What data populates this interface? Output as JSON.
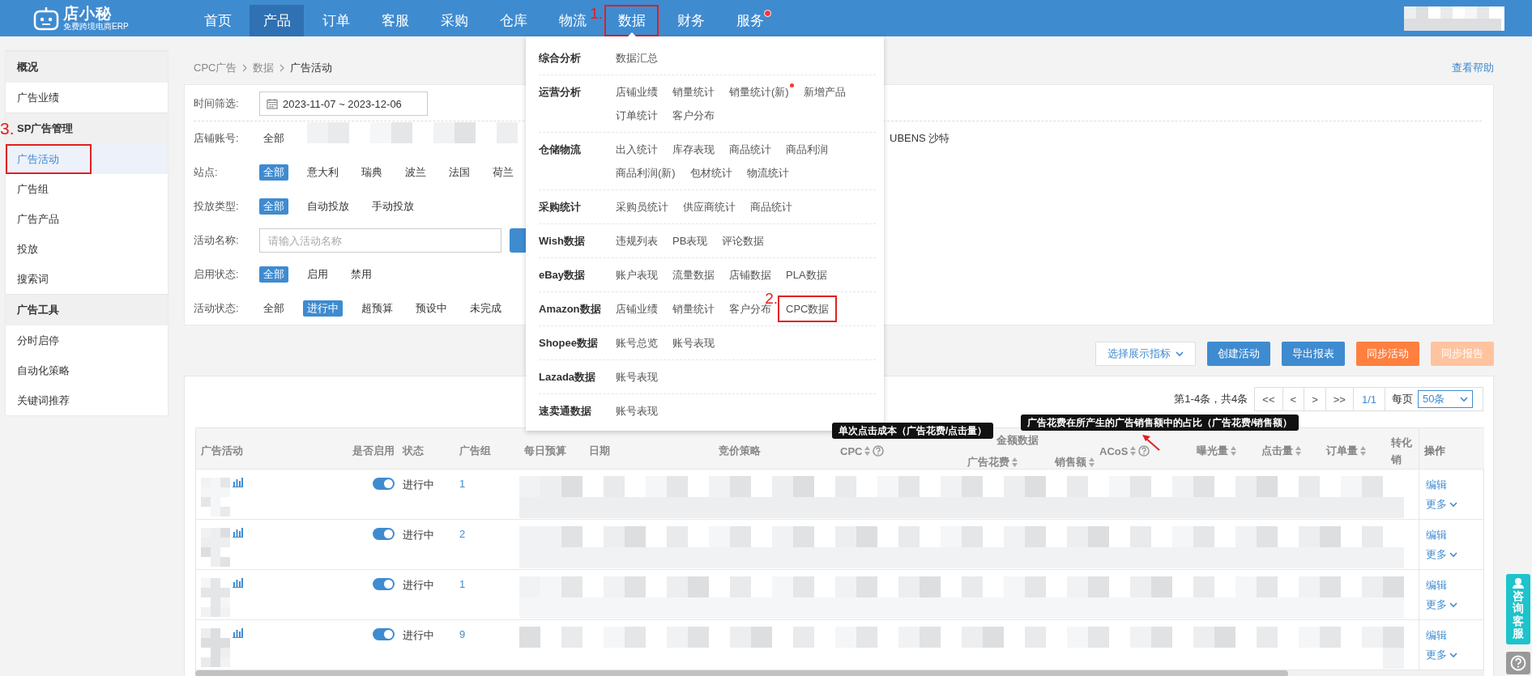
{
  "nav": {
    "logo": {
      "name": "店小秘",
      "tagline": "免费跨境电商ERP"
    },
    "items": [
      {
        "label": "首页",
        "selected": false,
        "expanded": false,
        "dot": false,
        "boxed": false
      },
      {
        "label": "产品",
        "selected": true,
        "expanded": false,
        "dot": false,
        "boxed": false
      },
      {
        "label": "订单",
        "selected": false,
        "expanded": false,
        "dot": false,
        "boxed": false
      },
      {
        "label": "客服",
        "selected": false,
        "expanded": false,
        "dot": false,
        "boxed": false
      },
      {
        "label": "采购",
        "selected": false,
        "expanded": false,
        "dot": false,
        "boxed": false
      },
      {
        "label": "仓库",
        "selected": false,
        "expanded": false,
        "dot": false,
        "boxed": false
      },
      {
        "label": "物流",
        "selected": false,
        "expanded": false,
        "dot": false,
        "boxed": false
      },
      {
        "label": "数据",
        "selected": false,
        "expanded": true,
        "dot": false,
        "boxed": true,
        "annotation": "1."
      },
      {
        "label": "财务",
        "selected": false,
        "expanded": false,
        "dot": false,
        "boxed": false
      },
      {
        "label": "服务",
        "selected": false,
        "expanded": false,
        "dot": true,
        "boxed": false
      }
    ]
  },
  "data_menu": {
    "groups": [
      {
        "title": "综合分析",
        "items": [
          {
            "label": "数据汇总",
            "dot": false,
            "boxed": false
          }
        ]
      },
      {
        "title": "运营分析",
        "items": [
          {
            "label": "店铺业绩",
            "dot": false,
            "boxed": false
          },
          {
            "label": "销量统计",
            "dot": false,
            "boxed": false
          },
          {
            "label": "销量统计(新)",
            "dot": true,
            "boxed": false
          },
          {
            "label": "新增产品",
            "dot": false,
            "boxed": false
          },
          {
            "label": "订单统计",
            "dot": false,
            "boxed": false
          },
          {
            "label": "客户分布",
            "dot": false,
            "boxed": false
          }
        ]
      },
      {
        "title": "仓储物流",
        "items": [
          {
            "label": "出入统计",
            "dot": false,
            "boxed": false
          },
          {
            "label": "库存表现",
            "dot": false,
            "boxed": false
          },
          {
            "label": "商品统计",
            "dot": false,
            "boxed": false
          },
          {
            "label": "商品利润",
            "dot": false,
            "boxed": false
          },
          {
            "label": "商品利润(新)",
            "dot": false,
            "boxed": false
          },
          {
            "label": "包材统计",
            "dot": false,
            "boxed": false
          },
          {
            "label": "物流统计",
            "dot": false,
            "boxed": false
          }
        ]
      },
      {
        "title": "采购统计",
        "items": [
          {
            "label": "采购员统计",
            "dot": false,
            "boxed": false
          },
          {
            "label": "供应商统计",
            "dot": false,
            "boxed": false
          },
          {
            "label": "商品统计",
            "dot": false,
            "boxed": false
          }
        ]
      },
      {
        "title": "Wish数据",
        "items": [
          {
            "label": "违规列表",
            "dot": false,
            "boxed": false
          },
          {
            "label": "PB表现",
            "dot": false,
            "boxed": false
          },
          {
            "label": "评论数据",
            "dot": false,
            "boxed": false
          }
        ]
      },
      {
        "title": "eBay数据",
        "items": [
          {
            "label": "账户表现",
            "dot": false,
            "boxed": false
          },
          {
            "label": "流量数据",
            "dot": false,
            "boxed": false
          },
          {
            "label": "店铺数据",
            "dot": false,
            "boxed": false
          },
          {
            "label": "PLA数据",
            "dot": false,
            "boxed": false
          }
        ]
      },
      {
        "title": "Amazon数据",
        "items": [
          {
            "label": "店铺业绩",
            "dot": false,
            "boxed": false
          },
          {
            "label": "销量统计",
            "dot": false,
            "boxed": false
          },
          {
            "label": "客户分布",
            "dot": false,
            "boxed": false
          },
          {
            "label": "CPC数据",
            "dot": false,
            "boxed": true,
            "annotation": "2."
          }
        ]
      },
      {
        "title": "Shopee数据",
        "items": [
          {
            "label": "账号总览",
            "dot": false,
            "boxed": false
          },
          {
            "label": "账号表现",
            "dot": false,
            "boxed": false
          }
        ]
      },
      {
        "title": "Lazada数据",
        "items": [
          {
            "label": "账号表现",
            "dot": false,
            "boxed": false
          }
        ]
      },
      {
        "title": "速卖通数据",
        "items": [
          {
            "label": "账号表现",
            "dot": false,
            "boxed": false
          }
        ]
      }
    ]
  },
  "sidebar": {
    "sections": [
      {
        "title": "概况",
        "items": [
          {
            "label": "广告业绩",
            "selected": false,
            "boxed": false
          }
        ]
      },
      {
        "title": "SP广告管理",
        "items": [
          {
            "label": "广告活动",
            "selected": true,
            "boxed": true,
            "annotation": "3."
          },
          {
            "label": "广告组",
            "selected": false,
            "boxed": false
          },
          {
            "label": "广告产品",
            "selected": false,
            "boxed": false
          },
          {
            "label": "投放",
            "selected": false,
            "boxed": false
          },
          {
            "label": "搜索词",
            "selected": false,
            "boxed": false
          }
        ]
      },
      {
        "title": "广告工具",
        "items": [
          {
            "label": "分时启停",
            "selected": false,
            "boxed": false
          },
          {
            "label": "自动化策略",
            "selected": false,
            "boxed": false
          },
          {
            "label": "关键词推荐",
            "selected": false,
            "boxed": false
          }
        ]
      }
    ]
  },
  "breadcrumb": [
    "CPC广告",
    "数据",
    "广告活动"
  ],
  "help_link": "查看帮助",
  "filters": [
    {
      "kind": "date",
      "label": "时间筛选:",
      "value": "2023-11-07 ~ 2023-12-06"
    },
    {
      "kind": "accounts",
      "label": "店铺账号:",
      "options": [
        {
          "label": "全部",
          "selected": false
        }
      ],
      "tail": "UBENS 沙特"
    },
    {
      "kind": "options",
      "label": "站点:",
      "options": [
        {
          "label": "全部",
          "selected": true
        },
        {
          "label": "意大利",
          "selected": false
        },
        {
          "label": "瑞典",
          "selected": false
        },
        {
          "label": "波兰",
          "selected": false
        },
        {
          "label": "法国",
          "selected": false
        },
        {
          "label": "荷兰",
          "selected": false
        }
      ]
    },
    {
      "kind": "options",
      "label": "投放类型:",
      "options": [
        {
          "label": "全部",
          "selected": true
        },
        {
          "label": "自动投放",
          "selected": false
        },
        {
          "label": "手动投放",
          "selected": false
        }
      ]
    },
    {
      "kind": "text",
      "label": "活动名称:",
      "placeholder": "请输入活动名称"
    },
    {
      "kind": "options",
      "label": "启用状态:",
      "options": [
        {
          "label": "全部",
          "selected": true
        },
        {
          "label": "启用",
          "selected": false
        },
        {
          "label": "禁用",
          "selected": false
        }
      ]
    },
    {
      "kind": "options",
      "label": "活动状态:",
      "options": [
        {
          "label": "全部",
          "selected": false
        },
        {
          "label": "进行中",
          "selected": true
        },
        {
          "label": "超预算",
          "selected": false
        },
        {
          "label": "预设中",
          "selected": false
        },
        {
          "label": "未完成",
          "selected": false
        }
      ]
    }
  ],
  "toolbar": [
    {
      "label": "选择展示指标",
      "kind": "dropdown",
      "disabled": false
    },
    {
      "label": "创建活动",
      "kind": "primary",
      "disabled": false
    },
    {
      "label": "导出报表",
      "kind": "primary",
      "disabled": false
    },
    {
      "label": "同步活动",
      "kind": "warning",
      "disabled": false
    },
    {
      "label": "同步报告",
      "kind": "warning",
      "disabled": true
    }
  ],
  "pagination": {
    "summary": "第1-4条，共4条",
    "buttons": [
      "<<",
      "<",
      ">",
      ">>"
    ],
    "page": "1/1",
    "per_page_label": "每页",
    "per_page": "50条"
  },
  "table": {
    "columns": [
      {
        "kind": "plain",
        "label": "广告活动",
        "sortable": false,
        "help": false
      },
      {
        "kind": "plain",
        "label": "是否启用",
        "sortable": false,
        "help": false
      },
      {
        "kind": "plain",
        "label": "状态",
        "sortable": false,
        "help": false
      },
      {
        "kind": "plain",
        "label": "广告组",
        "sortable": false,
        "help": false
      },
      {
        "kind": "plain",
        "label": "每日预算",
        "sortable": false,
        "help": false
      },
      {
        "kind": "plain",
        "label": "日期",
        "sortable": false,
        "help": false
      },
      {
        "kind": "plain",
        "label": "竞价策略",
        "sortable": false,
        "help": false
      },
      {
        "kind": "plain",
        "label": "CPC",
        "sortable": true,
        "help": true
      },
      {
        "kind": "group",
        "label": "金额数据",
        "columns": [
          {
            "label": "广告花费",
            "sortable": true,
            "help": false
          },
          {
            "label": "销售额",
            "sortable": true,
            "help": false
          }
        ]
      },
      {
        "kind": "plain",
        "label": "ACoS",
        "sortable": true,
        "help": true
      },
      {
        "kind": "plain",
        "label": "曝光量",
        "sortable": true,
        "help": false
      },
      {
        "kind": "plain",
        "label": "点击量",
        "sortable": true,
        "help": false
      },
      {
        "kind": "plain",
        "label": "订单量",
        "sortable": true,
        "help": false
      },
      {
        "kind": "cut",
        "label": "转化",
        "sub_label": "销"
      },
      {
        "kind": "plain",
        "label": "操作",
        "sortable": false,
        "help": false
      }
    ],
    "rows": [
      {
        "enabled": true,
        "status": "进行中",
        "ad_groups": "1",
        "edit": "编辑",
        "more": "更多"
      },
      {
        "enabled": true,
        "status": "进行中",
        "ad_groups": "2",
        "edit": "编辑",
        "more": "更多"
      },
      {
        "enabled": true,
        "status": "进行中",
        "ad_groups": "1",
        "edit": "编辑",
        "more": "更多"
      },
      {
        "enabled": true,
        "status": "进行中",
        "ad_groups": "9",
        "edit": "编辑",
        "more": "更多"
      }
    ]
  },
  "tooltips": [
    {
      "text": "单次点击成本（广告花费/点击量）",
      "pointer": false
    },
    {
      "text": "广告花费在所产生的广告销售额中的占比（广告花费/销售额）",
      "pointer": true
    }
  ],
  "support": {
    "label": "咨询客服"
  }
}
